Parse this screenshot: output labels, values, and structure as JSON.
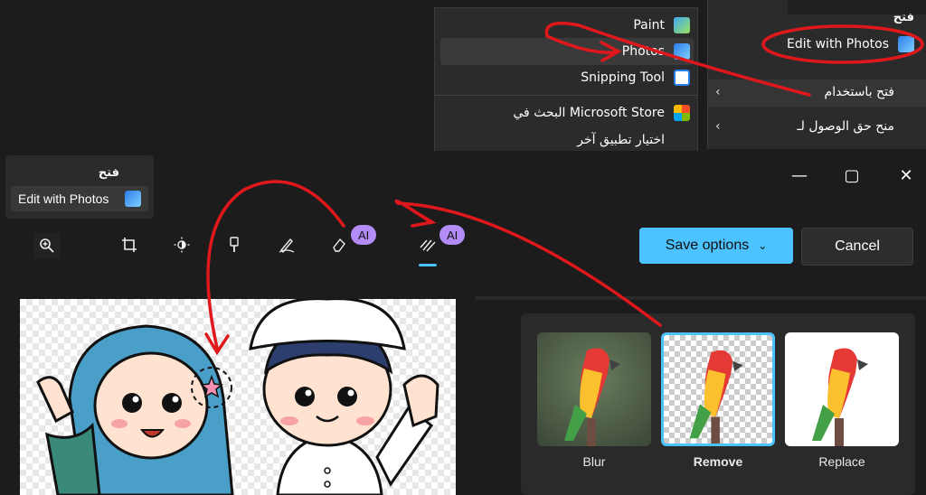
{
  "context_menu": {
    "items": [
      {
        "label": "Paint",
        "icon": "paint-icon"
      },
      {
        "label": "Photos",
        "icon": "photos-icon"
      },
      {
        "label": "Snipping Tool",
        "icon": "snipping-tool-icon"
      },
      {
        "label": "البحث في Microsoft Store",
        "icon": "store-icon"
      },
      {
        "label": "اختيار تطبيق آخر",
        "icon": ""
      }
    ]
  },
  "parent_menu": {
    "title": "فتح",
    "edit_with_photos": "Edit with Photos",
    "open_with": "فتح باستخدام",
    "give_access": "منح حق الوصول لـ"
  },
  "open_card": {
    "title": "فتح",
    "edit_with_photos": "Edit with Photos"
  },
  "toolbar": {
    "ai_badge": "AI",
    "save_options": "Save options",
    "cancel": "Cancel"
  },
  "background_panel": {
    "options": [
      {
        "label": "Blur",
        "selected": false
      },
      {
        "label": "Remove",
        "selected": true
      },
      {
        "label": "Replace",
        "selected": false
      }
    ]
  },
  "colors": {
    "accent": "#4cc2ff",
    "ai_badge": "#b48cf7",
    "annotation": "#e0181c"
  }
}
